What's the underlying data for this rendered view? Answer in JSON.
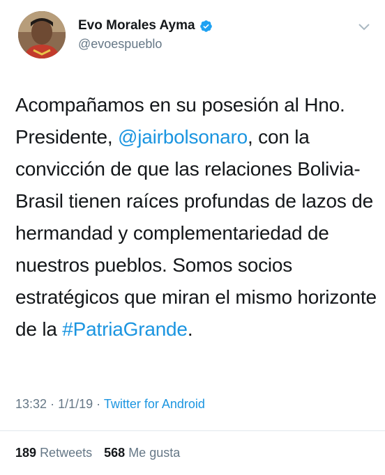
{
  "author": {
    "display_name": "Evo Morales Ayma",
    "handle": "@evoespueblo",
    "verified": true,
    "avatar_icon": "profile-photo"
  },
  "tweet": {
    "text_segments": [
      {
        "type": "text",
        "value": "Acompañamos en su posesión al Hno. Presidente, "
      },
      {
        "type": "mention",
        "value": "@jairbolsonaro"
      },
      {
        "type": "text",
        "value": ", con la convicción de que las relaciones Bolivia-Brasil tienen raíces profundas de lazos de hermandad y complementariedad de nuestros pueblos. Somos socios estratégicos que miran el mismo horizonte de la "
      },
      {
        "type": "hashtag",
        "value": "#PatriaGrande"
      },
      {
        "type": "text",
        "value": "."
      }
    ],
    "time": "13:32",
    "date": "1/1/19",
    "separator": "·",
    "source": "Twitter for Android"
  },
  "stats": {
    "retweets_count": "189",
    "retweets_label": "Retweets",
    "likes_count": "568",
    "likes_label": "Me gusta"
  },
  "colors": {
    "link": "#1b95e0",
    "muted": "#657786",
    "text": "#14171a",
    "verified": "#1da1f2"
  }
}
